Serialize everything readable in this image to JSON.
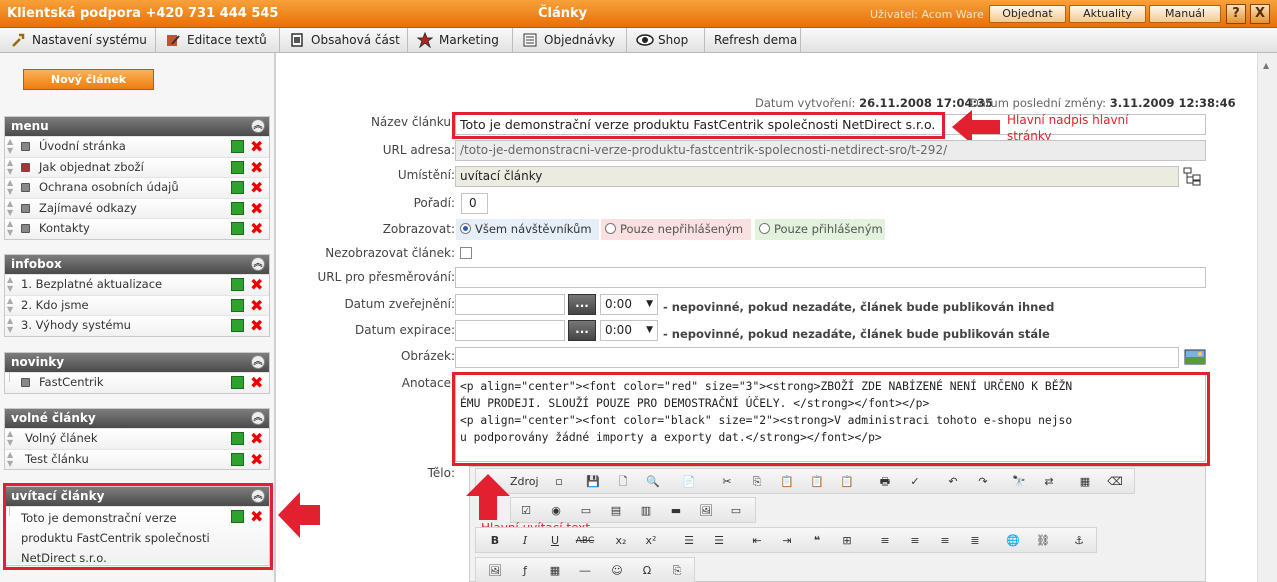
{
  "top_bar": {
    "support": "Klientská podpora +420 731 444 545",
    "page_title": "Články",
    "user_label": "Uživatel: Acom Ware",
    "buttons": [
      "Objednat",
      "Aktuality",
      "Manuál"
    ],
    "help": "?",
    "close": "X"
  },
  "menu": [
    {
      "label": "Nastavení systému",
      "icon": "wrench-icon"
    },
    {
      "label": "Editace textů",
      "icon": "pencil-icon"
    },
    {
      "label": "Obsahová část",
      "icon": "document-icon"
    },
    {
      "label": "Marketing",
      "icon": "star-icon"
    },
    {
      "label": "Objednávky",
      "icon": "list-icon"
    },
    {
      "label": "Shop",
      "icon": "eye-icon"
    },
    {
      "label": "Refresh dema",
      "icon": ""
    }
  ],
  "sidebar": {
    "new_button": "Nový článek",
    "sections": [
      {
        "title": "menu",
        "items": [
          "Úvodní stránka",
          "Jak objednat zboží",
          "Ochrana osobních údajů",
          "Zajímavé odkazy",
          "Kontakty"
        ]
      },
      {
        "title": "infobox",
        "items": [
          "1.  Bezplatné aktualizace",
          "2.  Kdo jsme",
          "3.  Výhody systému"
        ]
      },
      {
        "title": "novinky",
        "items": [
          "FastCentrik"
        ]
      },
      {
        "title": "volné články",
        "items": [
          "Volný článek",
          "Test článku"
        ]
      },
      {
        "title": "uvítací články",
        "items": [
          "Toto je demonstrační verze produktu FastCentrik společnosti NetDirect s.r.o."
        ]
      }
    ]
  },
  "meta": {
    "created_label": "Datum vytvoření:",
    "created_value": "26.11.2008 17:04:35",
    "modified_label": "Datum poslední změny:",
    "modified_value": "3.11.2009 12:38:46"
  },
  "form": {
    "title_label": "Název článku:",
    "title_value": "Toto je demonstrační verze produktu FastCentrik společnosti NetDirect s.r.o.",
    "url_label": "URL adresa:",
    "url_value": "/toto-je-demonstracni-verze-produktu-fastcentrik-spolecnosti-netdirect-sro/t-292/",
    "placement_label": "Umístění:",
    "placement_value": "uvítací články",
    "order_label": "Pořadí:",
    "order_value": "0",
    "display_label": "Zobrazovat:",
    "display_options": [
      "Všem návštěvníkům",
      "Pouze nepřihlášeným",
      "Pouze přihlášeným"
    ],
    "hide_label": "Nezobrazovat článek:",
    "redirect_label": "URL pro přesměrování:",
    "publish_label": "Datum zveřejnění:",
    "publish_time": "0:00",
    "publish_note": "- nepovinné, pokud nezadáte, článek bude publikován ihned",
    "expire_label": "Datum expirace:",
    "expire_time": "0:00",
    "expire_note": "- nepovinné, pokud nezadáte, článek bude publikován stále",
    "date_btn": "...",
    "image_label": "Obrázek:",
    "annotation_label": "Anotace:",
    "annotation_lines": [
      "<p align=\"center\"><font color=\"red\" size=\"3\"><strong>ZBOŽÍ ZDE NABÍZENÉ NENÍ URČENO K BĚŽN",
      "ÉMU PRODEJI. SLOUŽÍ POUZE PRO DEMOSTRAČNÍ ÚČELY. </strong></font></p>",
      "<p align=\"center\"><font color=\"black\" size=\"2\"><strong>V administraci tohoto e-shopu nejso",
      "u podporovány žádné importy a exporty dat.</strong></font></p>"
    ],
    "body_label": "Tělo:",
    "source_btn": "Zdroj"
  },
  "annotations": {
    "title_callout": "Hlavní nadpis hlavní stránky",
    "text_callout": "Hlavní uvítací text"
  },
  "colors": {
    "accent": "#f08a1c",
    "highlight": "#e32030"
  }
}
